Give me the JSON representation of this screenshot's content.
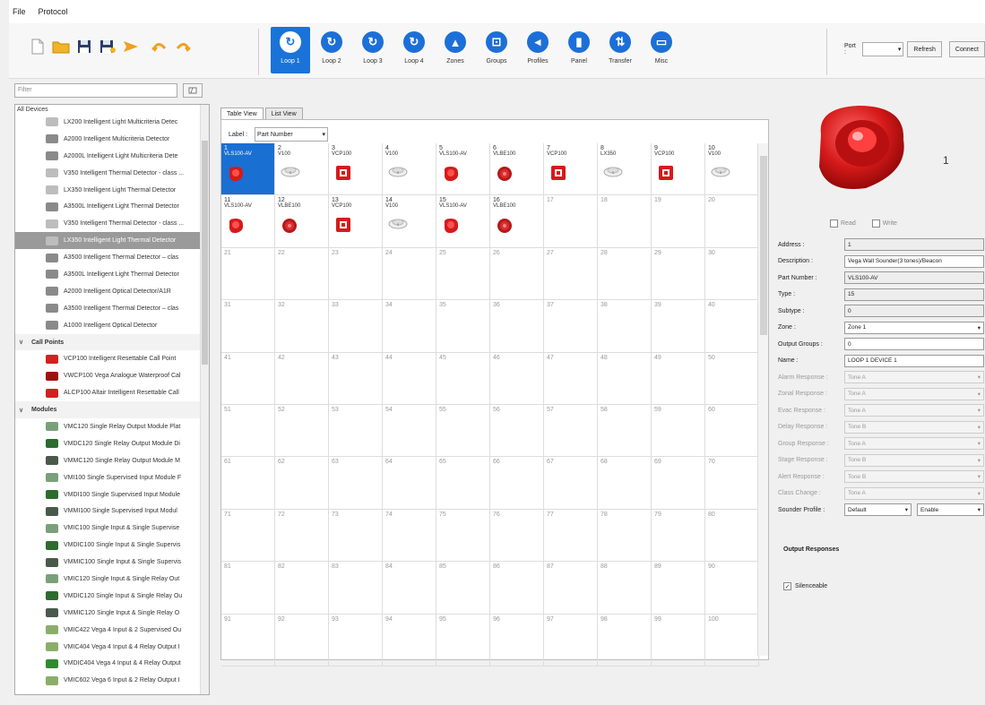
{
  "menu": {
    "file": "File",
    "protocol": "Protocol"
  },
  "toolbar": {
    "loops": [
      {
        "label": "Loop 1",
        "icon": "loop-icon",
        "glyph": "↻",
        "active": true
      },
      {
        "label": "Loop 2",
        "icon": "loop-icon",
        "glyph": "↻"
      },
      {
        "label": "Loop 3",
        "icon": "loop-icon",
        "glyph": "↻"
      },
      {
        "label": "Loop 4",
        "icon": "loop-icon",
        "glyph": "↻"
      },
      {
        "label": "Zones",
        "icon": "zones-icon",
        "glyph": "▲"
      },
      {
        "label": "Groups",
        "icon": "groups-icon",
        "glyph": "⊡"
      },
      {
        "label": "Profiles",
        "icon": "profiles-icon",
        "glyph": "◂"
      },
      {
        "label": "Panel",
        "icon": "panel-icon",
        "glyph": "▮"
      },
      {
        "label": "Transfer",
        "icon": "transfer-icon",
        "glyph": "⇅"
      },
      {
        "label": "Misc",
        "icon": "misc-icon",
        "glyph": "▭"
      }
    ],
    "port_label": "Port :",
    "port_value": "",
    "refresh": "Refresh",
    "connect": "Connect"
  },
  "left": {
    "filter_placeholder": "Filter",
    "root": "All Devices",
    "items": [
      {
        "type": "device",
        "text": "LX200 Intelligent Light Multicriteria Detec",
        "color": "#bdbdbd"
      },
      {
        "type": "device",
        "text": "A2000 Intelligent Multicriteria Detector",
        "color": "#8a8a8a"
      },
      {
        "type": "device",
        "text": "A2000L Intelligent Light Multicriteria Dete",
        "color": "#8a8a8a"
      },
      {
        "type": "device",
        "text": "V350 Intelligent Thermal Detector - class ...",
        "color": "#bdbdbd"
      },
      {
        "type": "device",
        "text": "LX350 Intelligent Light Thermal Detector",
        "color": "#bdbdbd"
      },
      {
        "type": "device",
        "text": "A3500L Intelligent Light Thermal Detector",
        "color": "#8a8a8a"
      },
      {
        "type": "device",
        "text": "V350 Intelligent Thermal Detector - class ...",
        "color": "#bdbdbd"
      },
      {
        "type": "device",
        "text": "LX350 Intelligent Light Thermal Detector",
        "color": "#bdbdbd",
        "selected": true
      },
      {
        "type": "device",
        "text": "A3500 Intelligent Thermal Detector – clas",
        "color": "#8a8a8a"
      },
      {
        "type": "device",
        "text": "A3500L Intelligent Light Thermal Detector",
        "color": "#8a8a8a"
      },
      {
        "type": "device",
        "text": "A2000 Intelligent Optical Detector/A1R",
        "color": "#8a8a8a"
      },
      {
        "type": "device",
        "text": "A3500 Intelligent Thermal Detector – clas",
        "color": "#8a8a8a"
      },
      {
        "type": "device",
        "text": "A1000 Intelligent Optical Detector",
        "color": "#8a8a8a"
      },
      {
        "type": "group",
        "text": "Call Points"
      },
      {
        "type": "device",
        "text": "VCP100 Intelligent Resettable Call Point",
        "color": "#d32020"
      },
      {
        "type": "device",
        "text": "VWCP100 Vega Analogue Waterproof Cal",
        "color": "#a01010"
      },
      {
        "type": "device",
        "text": "ALCP100 Altair Intelligent Resettable Call",
        "color": "#d32020"
      },
      {
        "type": "group",
        "text": "Modules"
      },
      {
        "type": "device",
        "text": "VMC120 Single Relay Output Module Plat",
        "color": "#7aa07a"
      },
      {
        "type": "device",
        "text": "VMDC120 Single Relay Output Module Di",
        "color": "#2e6b2e"
      },
      {
        "type": "device",
        "text": "VMMC120 Single Relay Output Module M",
        "color": "#4a5a4a"
      },
      {
        "type": "device",
        "text": "VMI100 Single Supervised Input Module F",
        "color": "#7aa07a"
      },
      {
        "type": "device",
        "text": "VMDI100 Single Supervised Input Module",
        "color": "#2e6b2e"
      },
      {
        "type": "device",
        "text": "VMMI100 Single Supervised Input Modul",
        "color": "#4a5a4a"
      },
      {
        "type": "device",
        "text": "VMIC100 Single Input & Single Supervise",
        "color": "#7aa07a"
      },
      {
        "type": "device",
        "text": "VMDIC100 Single Input & Single Supervis",
        "color": "#2e6b2e"
      },
      {
        "type": "device",
        "text": "VMMIC100 Single Input & Single Supervis",
        "color": "#4a5a4a"
      },
      {
        "type": "device",
        "text": "VMIC120 Single Input & Single Relay Out",
        "color": "#7aa07a"
      },
      {
        "type": "device",
        "text": "VMDIC120 Single Input & Single Relay Ou",
        "color": "#2e6b2e"
      },
      {
        "type": "device",
        "text": "VMMIC120 Single Input & Single Relay O",
        "color": "#4a5a4a"
      },
      {
        "type": "device",
        "text": "VMIC422 Vega 4 Input & 2 Supervised Ou",
        "color": "#8aae6a"
      },
      {
        "type": "device",
        "text": "VMIC404 Vega 4 Input & 4 Relay Output I",
        "color": "#8aae6a"
      },
      {
        "type": "device",
        "text": "VMDIC404 Vega 4 Input & 4 Relay Output",
        "color": "#2e8b2e"
      },
      {
        "type": "device",
        "text": "VMIC602 Vega 6 Input & 2 Relay Output I",
        "color": "#8aae6a"
      }
    ]
  },
  "center": {
    "tabs": [
      "Table View",
      "List View"
    ],
    "label_caption": "Label :",
    "label_value": "Part Number",
    "cells": [
      {
        "n": "1",
        "pn": "VLS100-AV",
        "icon": "sounder",
        "selected": true
      },
      {
        "n": "2",
        "pn": "V100",
        "icon": "detector"
      },
      {
        "n": "3",
        "pn": "VCP100",
        "icon": "callpoint"
      },
      {
        "n": "4",
        "pn": "V100",
        "icon": "detector"
      },
      {
        "n": "5",
        "pn": "VLS100-AV",
        "icon": "sounder"
      },
      {
        "n": "6",
        "pn": "VLBE100",
        "icon": "beacon"
      },
      {
        "n": "7",
        "pn": "VCP100",
        "icon": "callpoint"
      },
      {
        "n": "8",
        "pn": "LX350",
        "icon": "detector"
      },
      {
        "n": "9",
        "pn": "VCP100",
        "icon": "callpoint"
      },
      {
        "n": "10",
        "pn": "V100",
        "icon": "detector"
      },
      {
        "n": "11",
        "pn": "VLS100-AV",
        "icon": "sounder"
      },
      {
        "n": "12",
        "pn": "VLBE100",
        "icon": "beacon"
      },
      {
        "n": "13",
        "pn": "VCP100",
        "icon": "callpoint"
      },
      {
        "n": "14",
        "pn": "V100",
        "icon": "detector"
      },
      {
        "n": "15",
        "pn": "VLS100-AV",
        "icon": "sounder"
      },
      {
        "n": "16",
        "pn": "VLBE100",
        "icon": "beacon"
      }
    ],
    "total_cells": 100
  },
  "right": {
    "address_big": "1",
    "read": "Read",
    "write": "Write",
    "props": [
      {
        "k": "Address :",
        "v": "1",
        "ro": true
      },
      {
        "k": "Description :",
        "v": "Vega Wall Sounder(3 tones)/Beacon"
      },
      {
        "k": "Part Number :",
        "v": "VLS100-AV",
        "ro": true
      },
      {
        "k": "Type :",
        "v": "15",
        "ro": true
      },
      {
        "k": "Subtype :",
        "v": "0",
        "ro": true
      },
      {
        "k": "Zone :",
        "v": "Zone 1",
        "dd": true
      },
      {
        "k": "Output Groups :",
        "v": "0"
      },
      {
        "k": "Name :",
        "v": "LOOP 1 DEVICE 1"
      },
      {
        "k": "Alarm Response :",
        "v": "Tone A",
        "dd": true,
        "dis": true
      },
      {
        "k": "Zonal Response :",
        "v": "Tone A",
        "dd": true,
        "dis": true
      },
      {
        "k": "Evac Response :",
        "v": "Tone A",
        "dd": true,
        "dis": true
      },
      {
        "k": "Delay Response :",
        "v": "Tone B",
        "dd": true,
        "dis": true
      },
      {
        "k": "Group Response :",
        "v": "Tone A",
        "dd": true,
        "dis": true
      },
      {
        "k": "Stage Response :",
        "v": "Tone B",
        "dd": true,
        "dis": true
      },
      {
        "k": "Alert Response :",
        "v": "Tone B",
        "dd": true,
        "dis": true
      },
      {
        "k": "Class Change :",
        "v": "Tone A",
        "dd": true,
        "dis": true
      }
    ],
    "sounder_profile_label": "Sounder Profile :",
    "sounder_profile_value": "Default",
    "sounder_enable_value": "Enable",
    "output_responses": "Output Responses",
    "silenceable": "Silenceable"
  }
}
